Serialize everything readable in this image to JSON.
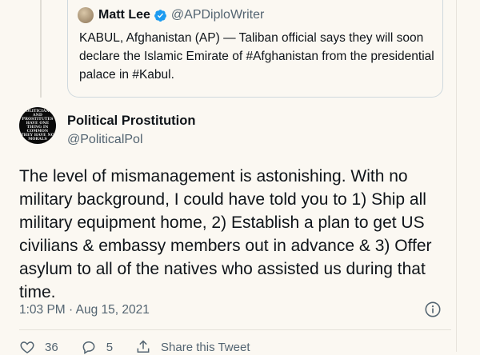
{
  "quoted_tweet": {
    "name": "Matt Lee",
    "handle": "@APDiploWriter",
    "text": "KABUL, Afghanistan (AP) — Taliban official says they will soon declare the Islamic Emirate of #Afghanistan from the presidential palace in #Kabul.",
    "avatar_icon": "avatar-photo",
    "verified_icon": "verified-badge-icon"
  },
  "tweet": {
    "author_name": "Political Prostitution",
    "author_handle": "@PoliticalPol",
    "avatar_text": [
      "POLITICIANS",
      "AND",
      "PROSTITUTES",
      "HAVE ONE",
      "THING IN",
      "COMMON",
      "THEY HAVE NO",
      "MORALS"
    ],
    "text": "The level of mismanagement is astonishing. With no military background, I could have told you to 1) Ship all military equipment home, 2) Establish a plan to get US civilians & embassy members out in advance & 3) Offer asylum to all of the natives who assisted us during that time.",
    "timestamp": "1:03 PM · Aug 15, 2021"
  },
  "actions": {
    "like_count": "36",
    "reply_count": "5",
    "share_label": "Share this Tweet"
  },
  "colors": {
    "background": "#fbf8f2",
    "text": "#0f1419",
    "muted": "#536471",
    "verified": "#1d9bf0"
  }
}
